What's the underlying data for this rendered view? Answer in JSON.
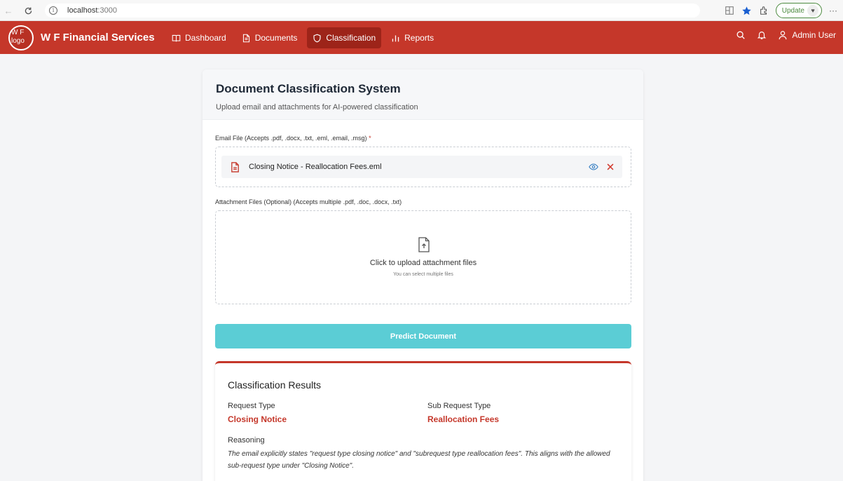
{
  "browser": {
    "url_host": "localhost",
    "url_port": ":3000",
    "update_label": "Update",
    "more_label": "···"
  },
  "app": {
    "brand": "W F Financial Services",
    "logo_alt": "W F logo",
    "nav": [
      {
        "label": "Dashboard",
        "icon": "book-icon"
      },
      {
        "label": "Documents",
        "icon": "file-icon"
      },
      {
        "label": "Classification",
        "icon": "shield-icon",
        "active": true
      },
      {
        "label": "Reports",
        "icon": "bar-chart-icon"
      }
    ],
    "user": "Admin User"
  },
  "card": {
    "title": "Document Classification System",
    "subtitle": "Upload email and attachments for AI-powered classification",
    "email_label": "Email File (Accepts .pdf, .docx, .txt, .eml, .email, .msg)",
    "required_mark": "*",
    "email_file": "Closing Notice - Reallocation Fees.eml",
    "attach_label": "Attachment Files (Optional) (Accepts multiple .pdf, .doc, .docx, .txt)",
    "upload_main": "Click to upload attachment files",
    "upload_sub": "You can select multiple files",
    "predict_label": "Predict Document"
  },
  "results": {
    "title": "Classification Results",
    "request_type_label": "Request Type",
    "request_type_value": "Closing Notice",
    "sub_request_type_label": "Sub Request Type",
    "sub_request_type_value": "Reallocation Fees",
    "reasoning_label": "Reasoning",
    "reasoning_text": "The email explicitly states \"request type closing notice\" and \"subrequest type reallocation fees\". This aligns with the allowed sub-request type under \"Closing Notice\"."
  },
  "colors": {
    "brand_red": "#c5372a",
    "active_nav": "#9d2419",
    "predict_button": "#5bcdd5"
  }
}
